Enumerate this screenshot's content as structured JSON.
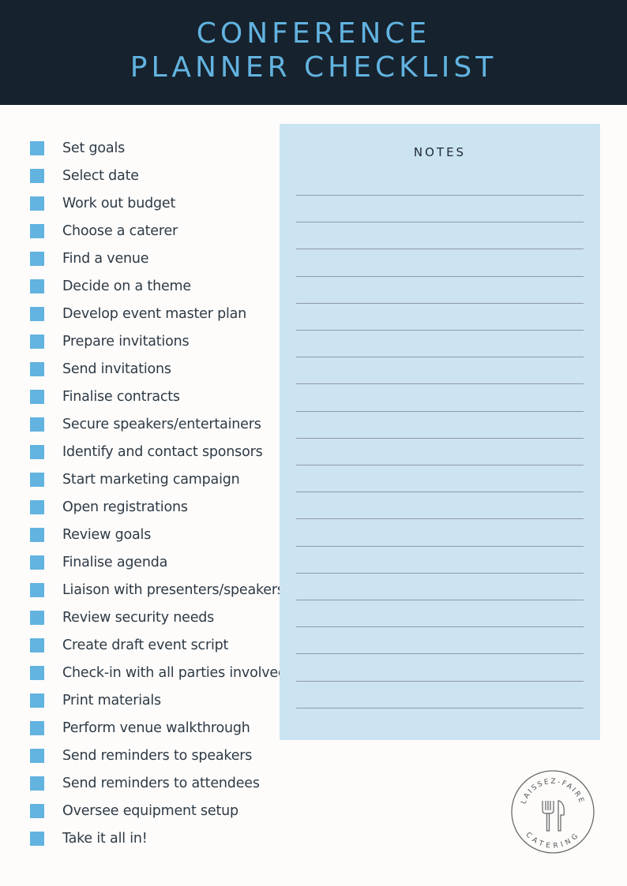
{
  "header": {
    "title_line1": "CONFERENCE",
    "title_line2": "PLANNER CHECKLIST"
  },
  "checklist": {
    "items": [
      {
        "label": "Set goals",
        "checked": false
      },
      {
        "label": "Select date",
        "checked": false
      },
      {
        "label": "Work out budget",
        "checked": false
      },
      {
        "label": "Choose a caterer",
        "checked": false
      },
      {
        "label": "Find a venue",
        "checked": false
      },
      {
        "label": "Decide on a theme",
        "checked": false
      },
      {
        "label": "Develop event master plan",
        "checked": false
      },
      {
        "label": "Prepare invitations",
        "checked": false
      },
      {
        "label": "Send invitations",
        "checked": false
      },
      {
        "label": "Finalise contracts",
        "checked": false
      },
      {
        "label": "Secure speakers/entertainers",
        "checked": false
      },
      {
        "label": "Identify and contact sponsors",
        "checked": false
      },
      {
        "label": "Start marketing campaign",
        "checked": false
      },
      {
        "label": "Open registrations",
        "checked": false
      },
      {
        "label": "Review goals",
        "checked": false
      },
      {
        "label": "Finalise agenda",
        "checked": false
      },
      {
        "label": "Liaison with presenters/speakers",
        "checked": false
      },
      {
        "label": "Review security needs",
        "checked": false
      },
      {
        "label": "Create draft event script",
        "checked": false
      },
      {
        "label": "Check-in with all parties involved",
        "checked": false
      },
      {
        "label": "Print materials",
        "checked": false
      },
      {
        "label": "Perform venue walkthrough",
        "checked": false
      },
      {
        "label": "Send reminders to speakers",
        "checked": false
      },
      {
        "label": "Send reminders to attendees",
        "checked": false
      },
      {
        "label": "Oversee equipment setup",
        "checked": false
      },
      {
        "label": "Take it all in!",
        "checked": false
      }
    ]
  },
  "notes": {
    "title": "NOTES",
    "line_count": 20
  },
  "logo": {
    "top_text": "LAISSEZ-FAIRE",
    "bottom_text": "CATERING",
    "icon": "fork-and-knife-icon"
  },
  "colors": {
    "header_bg": "#16222d",
    "accent": "#62b3e0",
    "notes_bg": "#cce3f1",
    "text": "#2e3a45"
  }
}
